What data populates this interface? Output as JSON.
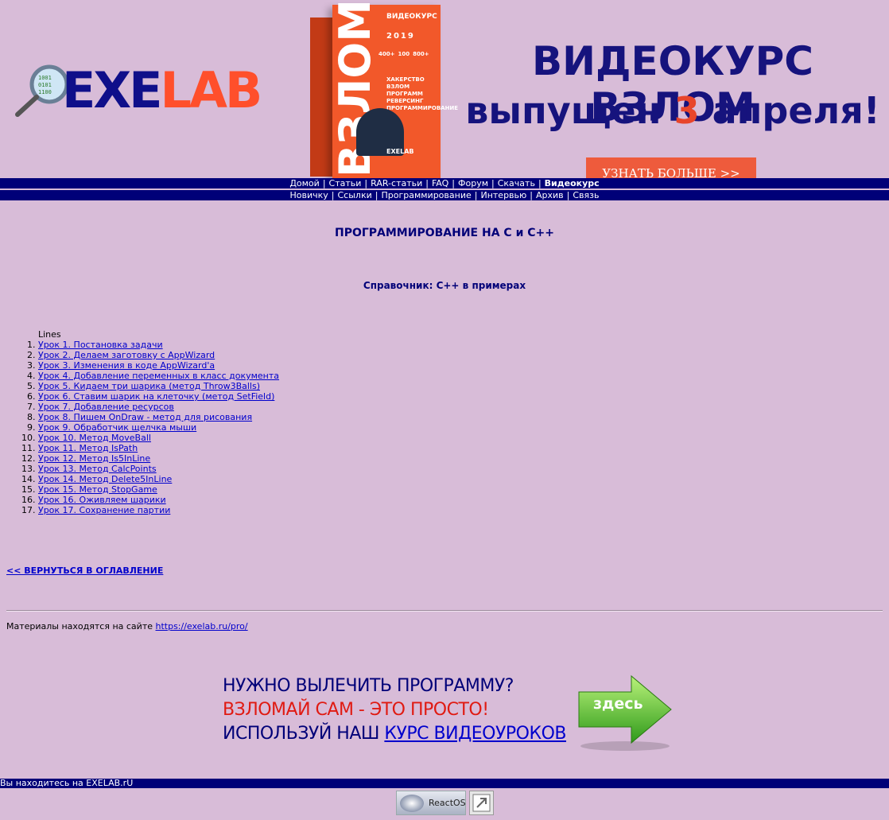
{
  "logo": {
    "part1": "EXE",
    "part2": "LAB"
  },
  "promo_box": {
    "head": "ВИДЕОКУРС",
    "year": "2019",
    "title_vertical": "ВЗЛОМ",
    "stats": [
      "400+",
      "100",
      "800+"
    ],
    "features": [
      "ХАКЕРСТВО",
      "ВЗЛОМ ПРОГРАММ",
      "РЕВЕРСИНГ",
      "ПРОГРАММИРОВАНИЕ"
    ],
    "brand": "EXELAB"
  },
  "banner": {
    "title": "ВИДЕОКУРС ВЗЛОМ",
    "sub_before": "выпущен ",
    "sub_num": "3",
    "sub_after": " апреля!",
    "button": "УЗНАТЬ БОЛЬШЕ >>"
  },
  "nav1": [
    "Домой",
    "Статьи",
    "RAR-статьи",
    "FAQ",
    "Форум",
    "Скачать",
    "Видеокурс"
  ],
  "nav2": [
    "Новичку",
    "Ссылки",
    "Программирование",
    "Интервью",
    "Архив",
    "Связь"
  ],
  "content": {
    "title": "ПРОГРАММИРОВАНИЕ НА C и C++",
    "subtitle": "Справочник: C++ в примерах",
    "list_heading": "Lines",
    "lessons": [
      "Урок 1. Постановка задачи",
      "Урок 2. Делаем заготовку с AppWizard",
      "Урок 3. Изменения в коде AppWizard'a",
      "Урок 4. Добавление переменных в класс документа",
      "Урок 5. Кидаем три шарика (метод Throw3Balls)",
      "Урок 6. Ставим шарик на клеточку (метод SetField)",
      "Урок 7. Добавление ресурсов",
      "Урок 8. Пишем OnDraw - метод для рисования",
      "Урок 9. Обработчик щелчка мыши",
      "Урок 10. Метод MoveBall",
      "Урок 11. Метод IsPath",
      "Урок 12. Метод Is5InLine",
      "Урок 13. Метод CalcPoints",
      "Урок 14. Метод Delete5InLine",
      "Урок 15. Метод StopGame",
      "Урок 16. Оживляем шарики",
      "Урок 17. Сохранение партии"
    ],
    "back_link": "<< ВЕРНУТЬСЯ В ОГЛАВЛЕНИЕ",
    "materials_text": "Материалы находятся на сайте ",
    "materials_link": "https://exelab.ru/pro/"
  },
  "promo": {
    "line1": "НУЖНО ВЫЛЕЧИТЬ ПРОГРАММУ?",
    "line2": "ВЗЛОМАЙ САМ - ЭТО ПРОСТО!",
    "line3_text": "ИСПОЛЬЗУЙ НАШ ",
    "line3_link": "КУРС ВИДЕОУРОКОВ",
    "arrow_label": "здесь"
  },
  "footer": {
    "text": "Вы находитесь на EXELAB.rU",
    "badge": "ReactOS"
  }
}
